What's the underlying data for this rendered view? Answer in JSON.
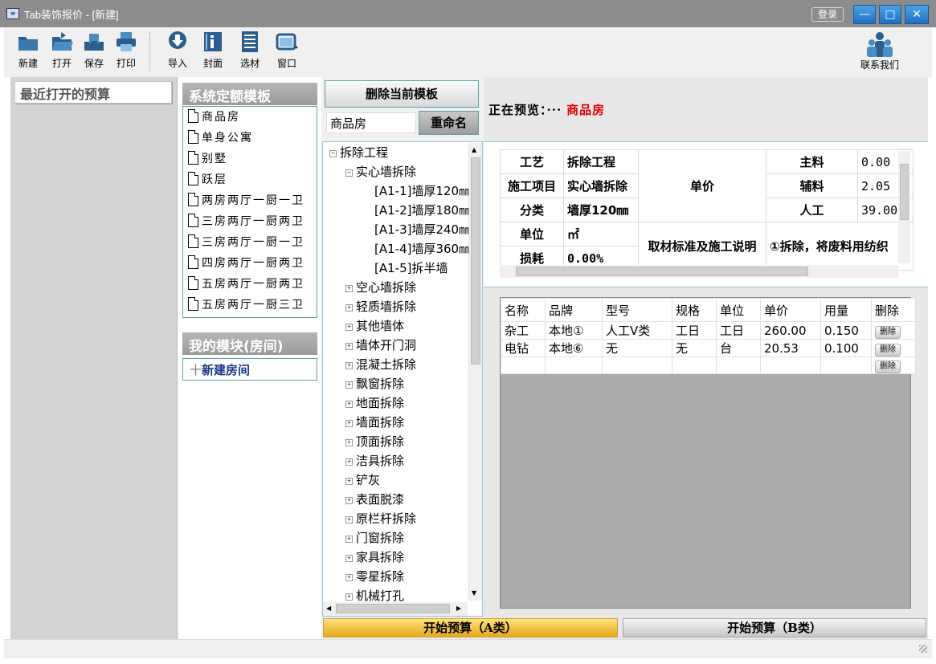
{
  "window": {
    "title": "Tab装饰报价 - [新建]",
    "login_label": "登录",
    "min_glyph": "—",
    "max_glyph": "□",
    "close_glyph": "✕"
  },
  "toolbar": {
    "new": "新建",
    "open": "打开",
    "save": "保存",
    "print": "打印",
    "import": "导入",
    "cover": "封面",
    "material": "选材",
    "window": "窗口",
    "contact": "联系我们"
  },
  "left": {
    "recent_label": "最近打开的预算"
  },
  "templates": {
    "header": "系统定额模板",
    "items": [
      "商品房",
      "单身公寓",
      "别墅",
      "跃层",
      "两房两厅一厨一卫",
      "三房两厅一厨两卫",
      "三房两厅一厨一卫",
      "四房两厅一厨两卫",
      "五房两厅一厨两卫",
      "五房两厅一厨三卫"
    ]
  },
  "modules": {
    "header": "我的模块(房间)",
    "new_room": "新建房间",
    "new_room_glyph": "十"
  },
  "actions": {
    "delete_template": "删除当前模板",
    "rename": "重命名",
    "rename_value": "商品房"
  },
  "tree": {
    "root": "拆除工程",
    "expanded": "实心墙拆除",
    "children": [
      "[A1-1]墙厚120㎜",
      "[A1-2]墙厚180㎜",
      "[A1-3]墙厚240㎜",
      "[A1-4]墙厚360㎜",
      "[A1-5]拆半墙"
    ],
    "siblings": [
      "空心墙拆除",
      "轻质墙拆除",
      "其他墙体",
      "墙体开门洞",
      "混凝土拆除",
      "飘窗拆除",
      "地面拆除",
      "墙面拆除",
      "顶面拆除",
      "洁具拆除",
      "铲灰",
      "表面脱漆",
      "原栏杆拆除",
      "门窗拆除",
      "家具拆除",
      "零星拆除",
      "机械打孔"
    ]
  },
  "preview": {
    "label": "正在预览：···",
    "name": "商品房"
  },
  "info": {
    "craft_label": "工艺",
    "craft_value": "拆除工程",
    "item_label": "施工项目",
    "item_value": "实心墙拆除",
    "category_label": "分类",
    "category_value": "墙厚120㎜",
    "unit_label": "单位",
    "unit_value": "㎡",
    "loss_label": "损耗",
    "loss_value": "0.00%",
    "unit_price_label": "单价",
    "main_label": "主料",
    "main_value": "0.00",
    "aux_label": "辅料",
    "aux_value": "2.05",
    "labor_label": "人工",
    "labor_value": "39.00",
    "standard_label": "取材标准及施工说明",
    "standard_value": "①拆除，将废料用纺织"
  },
  "grid": {
    "headers": [
      "名称",
      "品牌",
      "型号",
      "规格",
      "单位",
      "单价",
      "用量",
      "删除"
    ],
    "rows": [
      [
        "杂工",
        "本地①",
        "人工Ⅴ类",
        "工日",
        "工日",
        "260.00",
        "0.150"
      ],
      [
        "电钻",
        "本地⑥",
        "无",
        "无",
        "台",
        "20.53",
        "0.100"
      ],
      [
        "",
        "",
        "",
        "",
        "",
        "",
        ""
      ]
    ],
    "delete_label": "删除"
  },
  "bottom": {
    "start_a": "开始预算（A类）",
    "start_b": "开始预算（B类）"
  }
}
